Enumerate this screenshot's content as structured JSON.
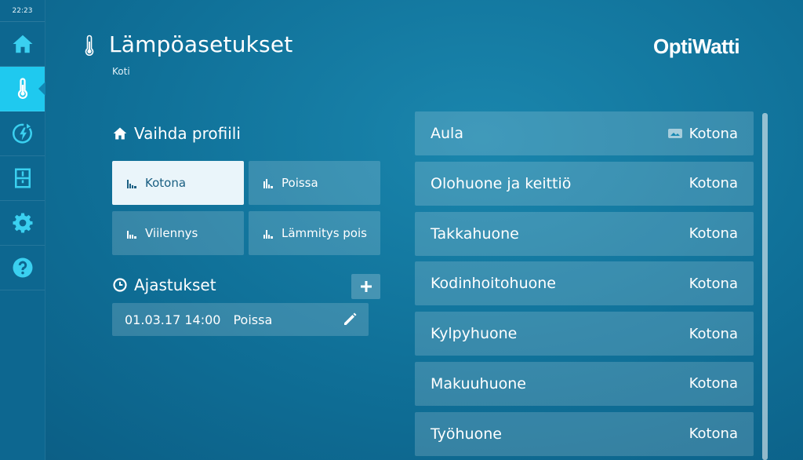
{
  "sidebar": {
    "time": "22:23",
    "items": [
      {
        "icon": "home-icon"
      },
      {
        "icon": "thermometer-icon",
        "active": true
      },
      {
        "icon": "energy-icon"
      },
      {
        "icon": "device-icon"
      },
      {
        "icon": "gear-icon"
      },
      {
        "icon": "help-icon"
      }
    ]
  },
  "header": {
    "title": "Lämpöasetukset",
    "subtitle": "Koti",
    "brand": "OptiWatti"
  },
  "profiles": {
    "heading": "Vaihda profiili",
    "buttons": [
      {
        "label": "Kotona",
        "selected": true
      },
      {
        "label": "Poissa"
      },
      {
        "label": "Viilennys"
      },
      {
        "label": "Lämmitys pois"
      }
    ]
  },
  "schedules": {
    "heading": "Ajastukset",
    "items": [
      {
        "datetime": "01.03.17 14:00",
        "profile": "Poissa"
      }
    ]
  },
  "rooms": [
    {
      "name": "Aula",
      "status": "Kotona",
      "status_icon": "display-icon"
    },
    {
      "name": "Olohuone ja keittiö",
      "status": "Kotona"
    },
    {
      "name": "Takkahuone",
      "status": "Kotona"
    },
    {
      "name": "Kodinhoitohuone",
      "status": "Kotona"
    },
    {
      "name": "Kylpyhuone",
      "status": "Kotona"
    },
    {
      "name": "Makuuhuone",
      "status": "Kotona"
    },
    {
      "name": "Työhuone",
      "status": "Kotona"
    }
  ],
  "colors": {
    "accent": "#1fc9ef",
    "icon": "#3ad0f0",
    "background": "#0f6f97"
  }
}
